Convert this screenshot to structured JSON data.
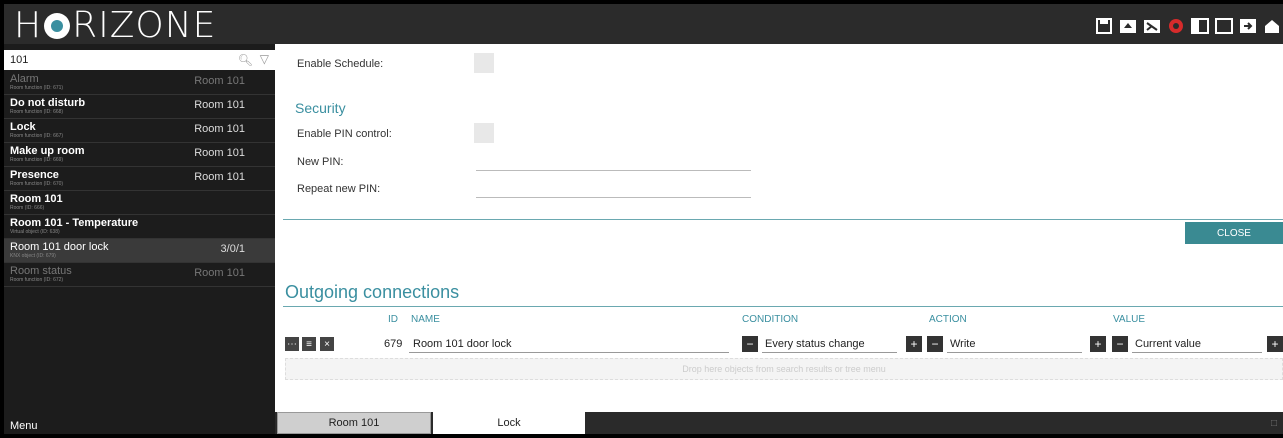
{
  "app": {
    "logo": "H RIZONE"
  },
  "toolbar": {
    "icons": [
      "save-icon",
      "import-icon",
      "export-icon",
      "settings-icon",
      "panel-icon",
      "panel-empty-icon",
      "logout-icon",
      "home-icon"
    ]
  },
  "search": {
    "value": "101"
  },
  "sidebar": {
    "items": [
      {
        "name": "Alarm",
        "sub": "Room function (ID: 671)",
        "right": "Room 101"
      },
      {
        "name": "Do not disturb",
        "sub": "Room function (ID: 668)",
        "right": "Room 101"
      },
      {
        "name": "Lock",
        "sub": "Room function (ID: 667)",
        "right": "Room 101"
      },
      {
        "name": "Make up room",
        "sub": "Room function (ID: 669)",
        "right": "Room 101"
      },
      {
        "name": "Presence",
        "sub": "Room function (ID: 670)",
        "right": "Room 101"
      },
      {
        "name": "Room 101",
        "sub": "Room (ID: 666)",
        "right": ""
      },
      {
        "name": "Room 101 - Temperature",
        "sub": "Virtual object (ID: 638)",
        "right": ""
      },
      {
        "name": "Room 101 door lock",
        "sub": "KNX object (ID: 679)",
        "right": "3/0/1"
      },
      {
        "name": "Room status",
        "sub": "Room function (ID: 672)",
        "right": "Room 101"
      }
    ],
    "menu": "Menu"
  },
  "form": {
    "enable_schedule": "Enable Schedule:",
    "security_title": "Security",
    "enable_pin": "Enable PIN control:",
    "new_pin": "New PIN:",
    "repeat_pin": "Repeat new PIN:",
    "close": "CLOSE"
  },
  "connections": {
    "title": "Outgoing connections",
    "headers": {
      "id": "ID",
      "name": "NAME",
      "condition": "CONDITION",
      "action": "ACTION",
      "value": "VALUE"
    },
    "row": {
      "id": "679",
      "name": "Room 101 door lock",
      "condition": "Every status change",
      "action": "Write",
      "value": "Current value"
    },
    "drop_hint": "Drop here objects from search results or tree menu"
  },
  "tabs": {
    "t1": "Room 101",
    "t2": "Lock"
  },
  "colors": {
    "accent": "#3a8fa0",
    "button": "#3a8a92"
  }
}
